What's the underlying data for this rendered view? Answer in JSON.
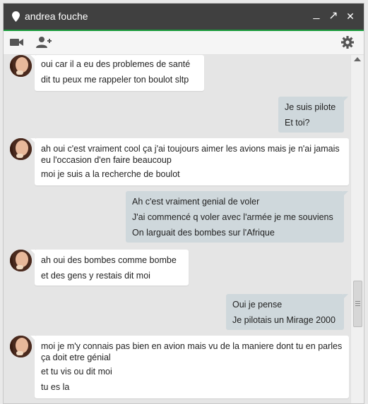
{
  "window": {
    "title": "andrea fouche",
    "accent_color": "#1a9b3c",
    "titlebar_color": "#404040"
  },
  "titlebar_buttons": {
    "minimize": "_",
    "popout": "↗",
    "close": "✕"
  },
  "messages": [
    {
      "from": "andrea",
      "lines": [
        "oui car il a eu des problemes de santé",
        "dit tu peux me rappeler ton boulot sltp"
      ]
    },
    {
      "from": "me",
      "lines": [
        "Je suis pilote",
        "Et toi?"
      ]
    },
    {
      "from": "andrea",
      "lines": [
        "ah oui c'est vraiment cool ça j'ai toujours aimer les avions mais je n'ai jamais eu l'occasion d'en faire beaucoup",
        "moi je suis a la recherche de boulot"
      ]
    },
    {
      "from": "me",
      "lines": [
        "Ah c'est vraiment genial de voler",
        "J'ai commencé q voler avec l'armée je me souviens",
        "On larguait des bombes sur l'Afrique"
      ]
    },
    {
      "from": "andrea",
      "lines": [
        "ah oui des bombes comme bombe",
        "et des gens y restais dit moi"
      ]
    },
    {
      "from": "me",
      "lines": [
        "Oui je pense",
        "Je pilotais un Mirage 2000"
      ]
    },
    {
      "from": "andrea",
      "lines": [
        "moi je m'y connais pas bien en avion mais vu de la maniere dont tu en parles  ça doit etre génial",
        "et tu vis ou dit moi",
        "tu es la"
      ]
    }
  ]
}
